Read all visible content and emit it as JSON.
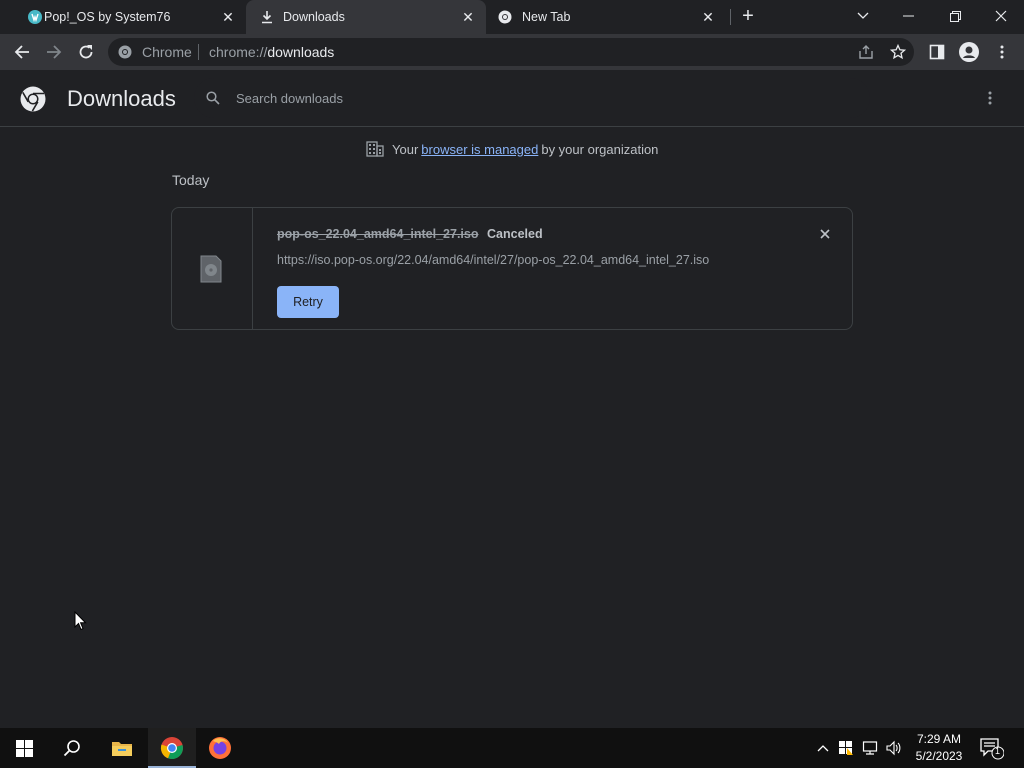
{
  "tabs": [
    {
      "title": "Pop!_OS by System76",
      "icon": "pop-os-favicon"
    },
    {
      "title": "Downloads",
      "icon": "download-icon",
      "active": true
    },
    {
      "title": "New Tab",
      "icon": "chrome-icon"
    }
  ],
  "omnibox": {
    "scheme_label": "Chrome",
    "url_prefix": "chrome://",
    "url_path": "downloads"
  },
  "page": {
    "title": "Downloads",
    "search_placeholder": "Search downloads"
  },
  "managed_notice": {
    "prefix": "Your",
    "link": "browser is managed",
    "suffix": "by your organization"
  },
  "section_title": "Today",
  "download": {
    "filename": "pop-os_22.04_amd64_intel_27.iso",
    "status": "Canceled",
    "url": "https://iso.pop-os.org/22.04/amd64/intel/27/pop-os_22.04_amd64_intel_27.iso",
    "retry_label": "Retry"
  },
  "taskbar": {
    "apps": [
      "start-icon",
      "search-icon",
      "file-explorer-icon",
      "chrome-icon",
      "firefox-icon"
    ],
    "time": "7:29 AM",
    "date": "5/2/2023",
    "notification_count": "1"
  },
  "colors": {
    "background": "#202124",
    "toolbar": "#35363a",
    "accent": "#8ab4f8",
    "taskbar": "#101010"
  }
}
